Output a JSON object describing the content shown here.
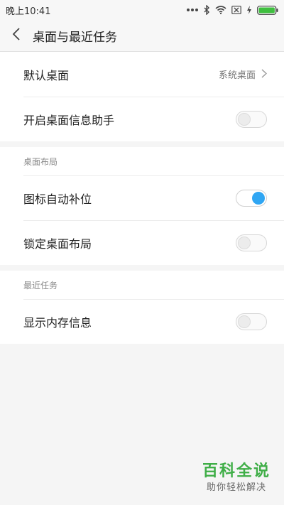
{
  "status_bar": {
    "time": "晚上10:41",
    "icons": [
      "dots-icon",
      "bluetooth-icon",
      "wifi-icon",
      "sim-off-icon",
      "charging-icon",
      "battery-icon"
    ]
  },
  "header": {
    "back_icon": "chevron-left-icon",
    "title": "桌面与最近任务"
  },
  "main": {
    "default_launcher": {
      "label": "默认桌面",
      "value": "系统桌面"
    },
    "launcher_assistant": {
      "label": "开启桌面信息助手",
      "enabled": false
    },
    "layout_section": {
      "title": "桌面布局",
      "auto_fill": {
        "label": "图标自动补位",
        "enabled": true
      },
      "lock_layout": {
        "label": "锁定桌面布局",
        "enabled": false
      }
    },
    "recents_section": {
      "title": "最近任务",
      "show_memory": {
        "label": "显示内存信息",
        "enabled": false
      }
    }
  },
  "watermark": {
    "title": "百科全说",
    "subtitle": "助你轻松解决"
  },
  "colors": {
    "accent": "#30a6f3",
    "watermark_green": "#3fae47"
  }
}
